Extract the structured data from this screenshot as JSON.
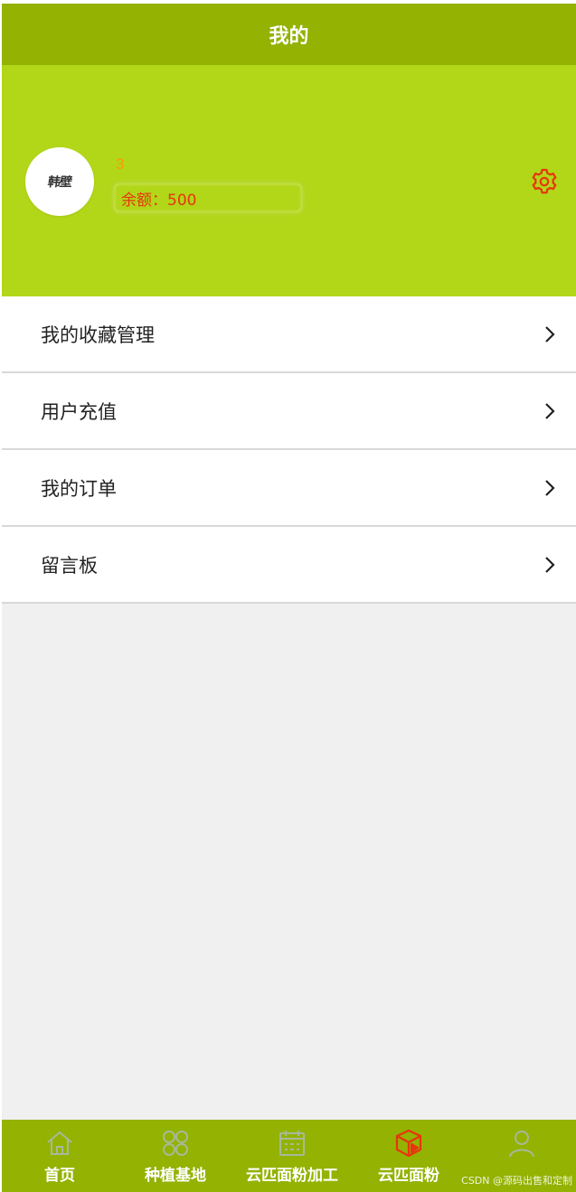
{
  "header": {
    "title": "我的"
  },
  "profile": {
    "avatar_text": "韩壁",
    "username": "3",
    "balance_label": "余额：500",
    "settings_icon": "gear-icon",
    "colors": {
      "username": "#ff9a00",
      "balance": "#e8340c",
      "settings": "#e8340c",
      "background": "#b2d618"
    }
  },
  "menu": {
    "items": [
      {
        "label": "我的收藏管理",
        "icon": "chevron-right-icon"
      },
      {
        "label": "用户充值",
        "icon": "chevron-right-icon"
      },
      {
        "label": "我的订单",
        "icon": "chevron-right-icon"
      },
      {
        "label": "留言板",
        "icon": "chevron-right-icon"
      }
    ]
  },
  "tabbar": {
    "items": [
      {
        "label": "首页",
        "icon": "home-icon"
      },
      {
        "label": "种植基地",
        "icon": "four-leaf-icon"
      },
      {
        "label": "云匹面粉加工",
        "icon": "calendar-icon"
      },
      {
        "label": "云匹面粉",
        "icon": "cube-icon",
        "active": true
      },
      {
        "label": "",
        "icon": "user-icon"
      }
    ],
    "colors": {
      "background": "#93b202",
      "active_icon": "#e8340c",
      "inactive_icon": "#a8b89a"
    }
  },
  "watermark": "CSDN @源码出售和定制"
}
